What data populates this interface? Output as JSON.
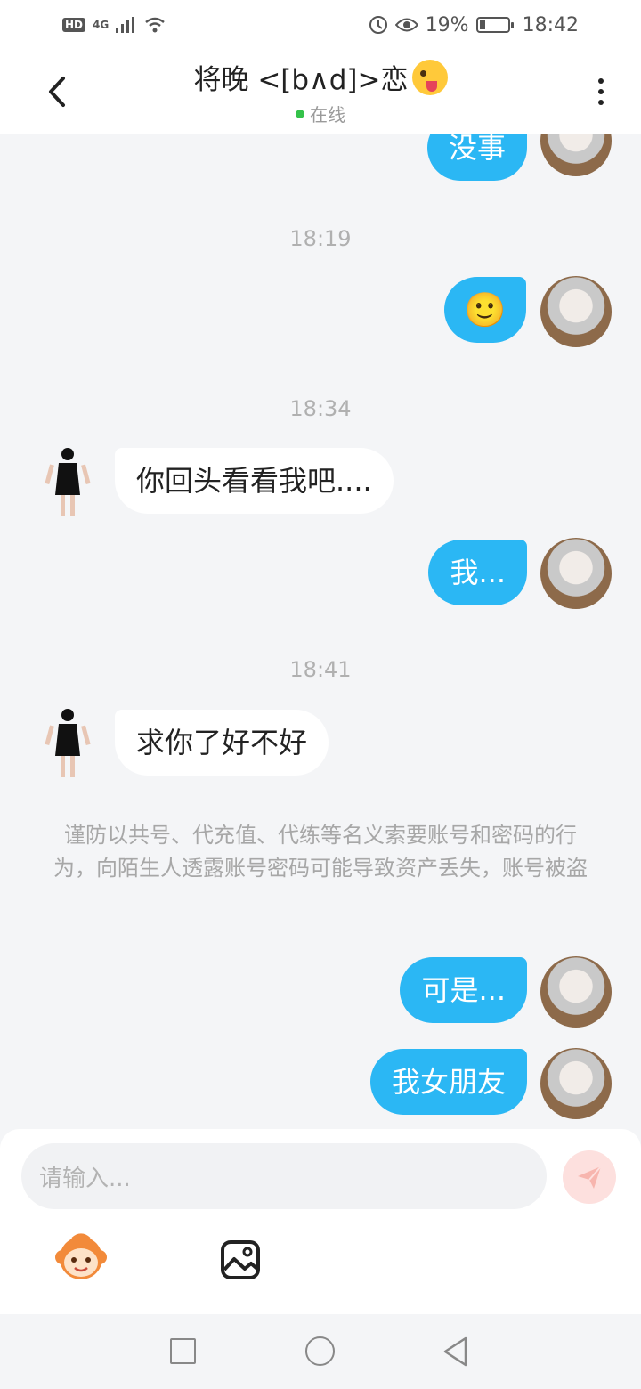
{
  "status_bar": {
    "left_badges": [
      "HD",
      "4G"
    ],
    "battery_percent": "19%",
    "time": "18:42"
  },
  "header": {
    "title": "将晚 <[b∧d]>恋",
    "status": "在线"
  },
  "messages": [
    {
      "type": "out",
      "text": "没事"
    },
    {
      "type": "time",
      "text": "18:19"
    },
    {
      "type": "out-emoji",
      "text": "🙂"
    },
    {
      "type": "time",
      "text": "18:34"
    },
    {
      "type": "in",
      "text": "你回头看看我吧...."
    },
    {
      "type": "out",
      "text": "我..."
    },
    {
      "type": "time",
      "text": "18:41"
    },
    {
      "type": "in",
      "text": "求你了好不好"
    },
    {
      "type": "notice",
      "text": "谨防以共号、代充值、代练等名义索要账号和密码的行为，向陌生人透露账号密码可能导致资产丢失，账号被盗"
    },
    {
      "type": "out",
      "text": "可是..."
    },
    {
      "type": "out",
      "text": "我女朋友"
    }
  ],
  "composer": {
    "placeholder": "请输入..."
  },
  "icons": {
    "back": "chevron-left-icon",
    "more": "more-vertical-icon",
    "send": "send-icon",
    "emoji": "monkey-emoji-icon",
    "image": "image-icon"
  },
  "colors": {
    "outgoing_bubble": "#2bb7f4",
    "incoming_bubble": "#ffffff",
    "background": "#f4f5f7",
    "online": "#35c24a",
    "send_disabled": "#fde0de"
  }
}
